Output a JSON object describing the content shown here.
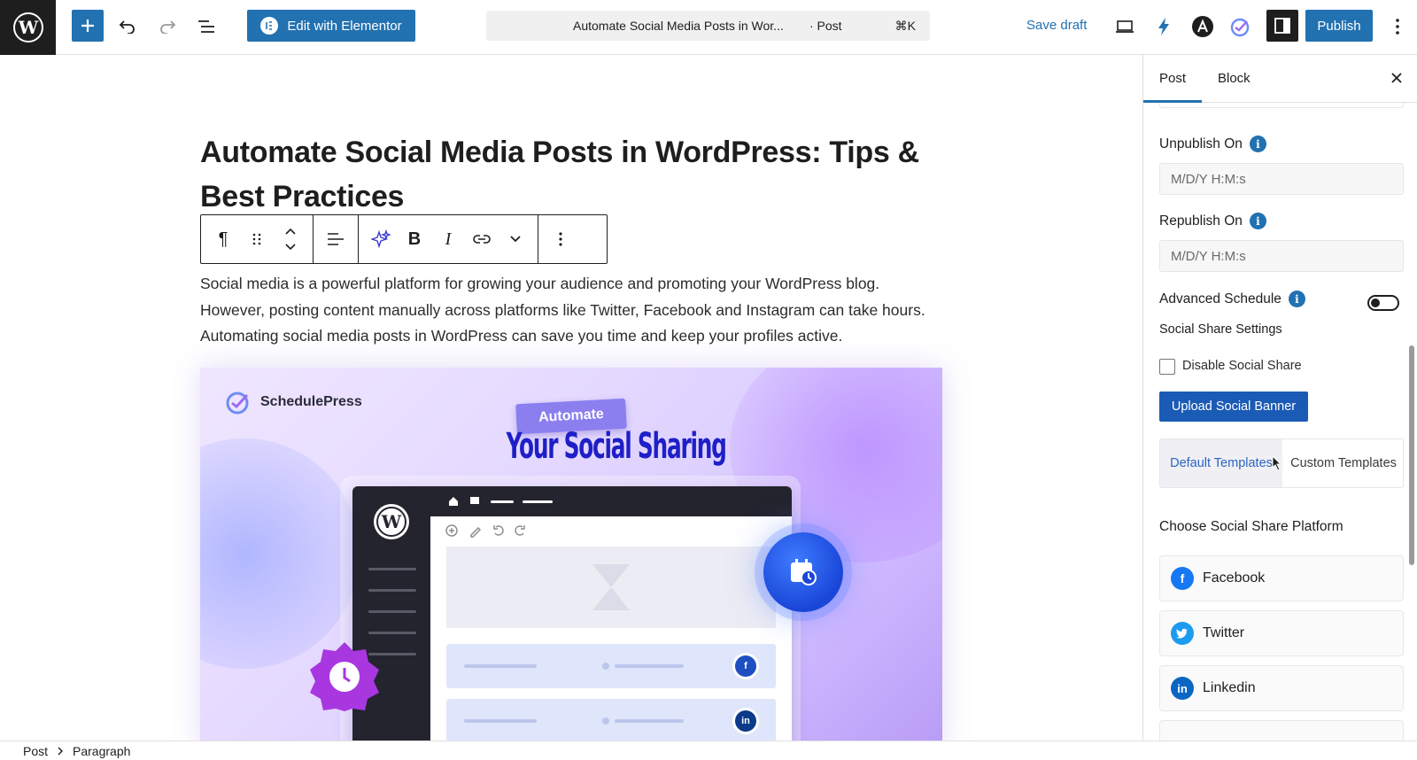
{
  "topbar": {
    "elementor_label": "Edit with Elementor",
    "doc_title": "Automate Social Media Posts in Wor...",
    "doc_type": "· Post",
    "doc_shortcut": "⌘K",
    "save_draft": "Save draft",
    "publish": "Publish"
  },
  "post": {
    "title": "Automate Social Media Posts in WordPress: Tips & Best Practices",
    "paragraph": "Social media is a powerful platform for growing your audience and promoting your WordPress blog. However, posting content manually across platforms like Twitter, Facebook and Instagram can take hours. Automating social media posts in WordPress can save you time and keep your profiles active."
  },
  "feature_image": {
    "brand": "SchedulePress",
    "tag": "Automate",
    "headline": "Your Social Sharing"
  },
  "sidebar": {
    "tabs": [
      "Post",
      "Block"
    ],
    "unpublish_label": "Unpublish On",
    "unpublish_placeholder": "M/D/Y H:M:s",
    "republish_label": "Republish On",
    "republish_placeholder": "M/D/Y H:M:s",
    "advanced_schedule_label": "Advanced Schedule",
    "social_share_settings": "Social Share Settings",
    "disable_social_share": "Disable Social Share",
    "upload_banner": "Upload Social Banner",
    "template_tabs": [
      "Default Templates",
      "Custom Templates"
    ],
    "choose_platform": "Choose Social Share Platform",
    "platforms": [
      {
        "name": "Facebook",
        "color": "#1877f2",
        "icon": "facebook-icon"
      },
      {
        "name": "Twitter",
        "color": "#1d9bf0",
        "icon": "twitter-icon"
      },
      {
        "name": "Linkedin",
        "color": "#0a66c2",
        "icon": "linkedin-icon"
      }
    ]
  },
  "footer": {
    "breadcrumb": [
      "Post",
      "Paragraph"
    ]
  },
  "colors": {
    "accent": "#2271b1",
    "dark": "#1e1e1e"
  }
}
